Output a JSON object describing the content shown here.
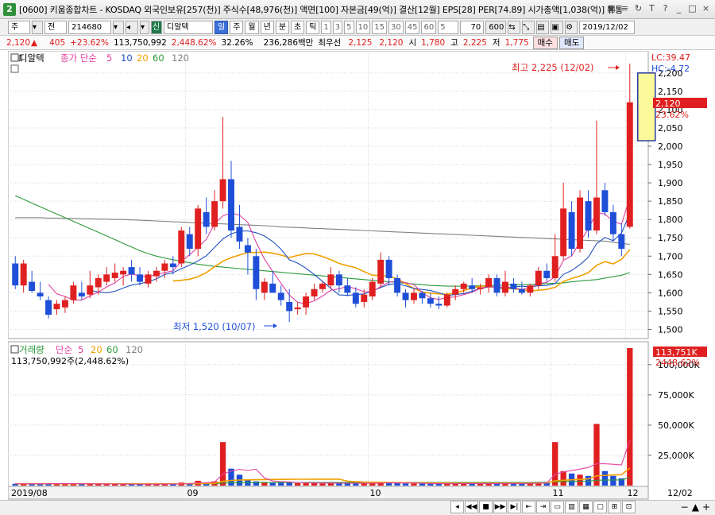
{
  "window": {
    "title": "[0600] 키움종합차트 - KOSDAQ 외국인보유[257(천)] 주식수[48,976(천)] 액면[100] 자본금[49(억)] 결산[12월] EPS[28] PER[74.89] 시가총액[1,038(억)] 유통비",
    "icon_text": "2",
    "buttons": [
      "▣",
      "≡",
      "↻",
      "T",
      "?",
      "_",
      "□",
      "×"
    ]
  },
  "toolbar": {
    "type": "주",
    "market": "전",
    "code": "214680",
    "badge": "신",
    "name": "디알텍",
    "periods": [
      "일",
      "주",
      "월",
      "년",
      "분",
      "초",
      "틱"
    ],
    "minutes": [
      "1",
      "3",
      "5",
      "10",
      "15",
      "30",
      "45",
      "60",
      "5"
    ],
    "count": "70",
    "total": "600",
    "date": "2019/12/02"
  },
  "quote": {
    "price": "2,120",
    "arrow": "▲",
    "change": "405",
    "pct": "+23.62%",
    "volume": "113,750,992",
    "vol_pct": "2,448.62%",
    "turnover": "32.26%",
    "amount": "236,286백만",
    "pref_label": "최우선",
    "ask": "2,125",
    "bid": "2,120",
    "open_label": "시",
    "open": "1,780",
    "high_label": "고",
    "high": "2,225",
    "low_label": "저",
    "low": "1,775",
    "sell": "매수",
    "buy": "매도"
  },
  "price_panel": {
    "name": "디알텍",
    "legend_prefix": "종가 단순",
    "ma": [
      "5",
      "10",
      "20",
      "60",
      "120"
    ],
    "lc": "LC:39.47",
    "hc": "HC:-4.72",
    "last_price": "2,120",
    "last_pct": "23.62%",
    "max_label": "최고 2,225 (12/02)",
    "min_label": "최저 1,520 (10/07)"
  },
  "volume_panel": {
    "legend_name": "거래량",
    "legend_prefix": "단순",
    "ma": [
      "5",
      "20",
      "60",
      "120"
    ],
    "info": "113,750,992주(2,448.62%)",
    "last_vol": "113,751K",
    "last_pct": "2448.62%"
  },
  "x_axis": [
    "2019/08",
    "09",
    "10",
    "11",
    "12",
    "12/02"
  ],
  "colors": {
    "up": "#e02020",
    "down": "#1f4fd8",
    "ma5": "#e040a0",
    "ma10": "#2050c0",
    "ma20": "#f0a000",
    "ma60": "#2a9a3a",
    "ma120": "#808080"
  },
  "chart_data": {
    "type": "candlestick",
    "y_price_ticks": [
      "2,200",
      "2,150",
      "2,100",
      "2,050",
      "2,000",
      "1,950",
      "1,900",
      "1,850",
      "1,800",
      "1,750",
      "1,700",
      "1,650",
      "1,600",
      "1,550",
      "1,500"
    ],
    "y_price_range": [
      1475,
      2230
    ],
    "y_volume_ticks": [
      "100,000K",
      "75,000K",
      "50,000K",
      "25,000K"
    ],
    "y_volume_range": [
      0,
      115000
    ],
    "candles": [
      {
        "o": 1680,
        "h": 1700,
        "l": 1610,
        "c": 1620,
        "v": 1500
      },
      {
        "o": 1620,
        "h": 1690,
        "l": 1600,
        "c": 1680,
        "v": 1500
      },
      {
        "o": 1630,
        "h": 1660,
        "l": 1600,
        "c": 1605,
        "v": 1500
      },
      {
        "o": 1600,
        "h": 1630,
        "l": 1580,
        "c": 1590,
        "v": 1500
      },
      {
        "o": 1580,
        "h": 1590,
        "l": 1530,
        "c": 1540,
        "v": 1800
      },
      {
        "o": 1555,
        "h": 1580,
        "l": 1540,
        "c": 1570,
        "v": 1500
      },
      {
        "o": 1560,
        "h": 1590,
        "l": 1545,
        "c": 1580,
        "v": 1500
      },
      {
        "o": 1580,
        "h": 1630,
        "l": 1570,
        "c": 1620,
        "v": 1500
      },
      {
        "o": 1600,
        "h": 1630,
        "l": 1580,
        "c": 1590,
        "v": 1200
      },
      {
        "o": 1595,
        "h": 1660,
        "l": 1585,
        "c": 1620,
        "v": 1200
      },
      {
        "o": 1615,
        "h": 1650,
        "l": 1595,
        "c": 1640,
        "v": 1200
      },
      {
        "o": 1630,
        "h": 1670,
        "l": 1620,
        "c": 1650,
        "v": 1200
      },
      {
        "o": 1640,
        "h": 1680,
        "l": 1630,
        "c": 1655,
        "v": 1200
      },
      {
        "o": 1650,
        "h": 1670,
        "l": 1620,
        "c": 1660,
        "v": 1200
      },
      {
        "o": 1670,
        "h": 1690,
        "l": 1630,
        "c": 1650,
        "v": 1200
      },
      {
        "o": 1650,
        "h": 1670,
        "l": 1620,
        "c": 1630,
        "v": 1200
      },
      {
        "o": 1625,
        "h": 1660,
        "l": 1615,
        "c": 1650,
        "v": 1200
      },
      {
        "o": 1645,
        "h": 1670,
        "l": 1630,
        "c": 1660,
        "v": 1200
      },
      {
        "o": 1660,
        "h": 1690,
        "l": 1640,
        "c": 1680,
        "v": 1300
      },
      {
        "o": 1680,
        "h": 1700,
        "l": 1650,
        "c": 1670,
        "v": 1300
      },
      {
        "o": 1680,
        "h": 1780,
        "l": 1670,
        "c": 1770,
        "v": 2500
      },
      {
        "o": 1760,
        "h": 1780,
        "l": 1700,
        "c": 1720,
        "v": 2000
      },
      {
        "o": 1720,
        "h": 1840,
        "l": 1700,
        "c": 1830,
        "v": 4000
      },
      {
        "o": 1820,
        "h": 1860,
        "l": 1760,
        "c": 1780,
        "v": 2500
      },
      {
        "o": 1780,
        "h": 1880,
        "l": 1770,
        "c": 1850,
        "v": 3500
      },
      {
        "o": 1850,
        "h": 2080,
        "l": 1830,
        "c": 1910,
        "v": 36000
      },
      {
        "o": 1910,
        "h": 1960,
        "l": 1750,
        "c": 1770,
        "v": 14000
      },
      {
        "o": 1780,
        "h": 1840,
        "l": 1720,
        "c": 1740,
        "v": 9000
      },
      {
        "o": 1730,
        "h": 1750,
        "l": 1650,
        "c": 1710,
        "v": 5000
      },
      {
        "o": 1700,
        "h": 1720,
        "l": 1580,
        "c": 1610,
        "v": 3500
      },
      {
        "o": 1600,
        "h": 1640,
        "l": 1580,
        "c": 1630,
        "v": 3000
      },
      {
        "o": 1625,
        "h": 1660,
        "l": 1600,
        "c": 1600,
        "v": 2500
      },
      {
        "o": 1600,
        "h": 1620,
        "l": 1565,
        "c": 1580,
        "v": 2500
      },
      {
        "o": 1575,
        "h": 1610,
        "l": 1520,
        "c": 1550,
        "v": 3000
      },
      {
        "o": 1555,
        "h": 1575,
        "l": 1540,
        "c": 1560,
        "v": 2000
      },
      {
        "o": 1560,
        "h": 1600,
        "l": 1540,
        "c": 1590,
        "v": 2000
      },
      {
        "o": 1590,
        "h": 1625,
        "l": 1580,
        "c": 1610,
        "v": 2000
      },
      {
        "o": 1610,
        "h": 1630,
        "l": 1600,
        "c": 1625,
        "v": 1800
      },
      {
        "o": 1620,
        "h": 1670,
        "l": 1610,
        "c": 1650,
        "v": 2000
      },
      {
        "o": 1650,
        "h": 1660,
        "l": 1600,
        "c": 1620,
        "v": 2000
      },
      {
        "o": 1620,
        "h": 1640,
        "l": 1590,
        "c": 1600,
        "v": 2000
      },
      {
        "o": 1600,
        "h": 1615,
        "l": 1560,
        "c": 1570,
        "v": 1800
      },
      {
        "o": 1575,
        "h": 1610,
        "l": 1560,
        "c": 1595,
        "v": 1800
      },
      {
        "o": 1590,
        "h": 1640,
        "l": 1580,
        "c": 1630,
        "v": 2000
      },
      {
        "o": 1625,
        "h": 1710,
        "l": 1615,
        "c": 1690,
        "v": 3000
      },
      {
        "o": 1690,
        "h": 1700,
        "l": 1620,
        "c": 1640,
        "v": 2500
      },
      {
        "o": 1640,
        "h": 1650,
        "l": 1590,
        "c": 1600,
        "v": 2000
      },
      {
        "o": 1600,
        "h": 1610,
        "l": 1560,
        "c": 1580,
        "v": 1800
      },
      {
        "o": 1580,
        "h": 1610,
        "l": 1570,
        "c": 1600,
        "v": 1800
      },
      {
        "o": 1600,
        "h": 1605,
        "l": 1570,
        "c": 1585,
        "v": 1600
      },
      {
        "o": 1585,
        "h": 1600,
        "l": 1560,
        "c": 1570,
        "v": 1600
      },
      {
        "o": 1570,
        "h": 1590,
        "l": 1555,
        "c": 1565,
        "v": 1600
      },
      {
        "o": 1565,
        "h": 1600,
        "l": 1560,
        "c": 1595,
        "v": 1600
      },
      {
        "o": 1595,
        "h": 1620,
        "l": 1580,
        "c": 1610,
        "v": 1800
      },
      {
        "o": 1610,
        "h": 1630,
        "l": 1600,
        "c": 1625,
        "v": 1800
      },
      {
        "o": 1620,
        "h": 1640,
        "l": 1600,
        "c": 1610,
        "v": 1600
      },
      {
        "o": 1610,
        "h": 1625,
        "l": 1595,
        "c": 1615,
        "v": 1600
      },
      {
        "o": 1615,
        "h": 1650,
        "l": 1600,
        "c": 1640,
        "v": 1800
      },
      {
        "o": 1640,
        "h": 1650,
        "l": 1590,
        "c": 1600,
        "v": 1800
      },
      {
        "o": 1600,
        "h": 1660,
        "l": 1590,
        "c": 1630,
        "v": 2000
      },
      {
        "o": 1625,
        "h": 1640,
        "l": 1600,
        "c": 1610,
        "v": 1800
      },
      {
        "o": 1610,
        "h": 1630,
        "l": 1595,
        "c": 1600,
        "v": 1600
      },
      {
        "o": 1600,
        "h": 1625,
        "l": 1590,
        "c": 1620,
        "v": 1800
      },
      {
        "o": 1620,
        "h": 1670,
        "l": 1610,
        "c": 1660,
        "v": 3000
      },
      {
        "o": 1660,
        "h": 1680,
        "l": 1630,
        "c": 1640,
        "v": 3000
      },
      {
        "o": 1640,
        "h": 1760,
        "l": 1630,
        "c": 1700,
        "v": 36000
      },
      {
        "o": 1700,
        "h": 1900,
        "l": 1690,
        "c": 1830,
        "v": 12000
      },
      {
        "o": 1820,
        "h": 1850,
        "l": 1700,
        "c": 1720,
        "v": 10000
      },
      {
        "o": 1720,
        "h": 1880,
        "l": 1710,
        "c": 1860,
        "v": 9000
      },
      {
        "o": 1850,
        "h": 1880,
        "l": 1750,
        "c": 1770,
        "v": 8000
      },
      {
        "o": 1770,
        "h": 2070,
        "l": 1760,
        "c": 1860,
        "v": 51000
      },
      {
        "o": 1880,
        "h": 1900,
        "l": 1810,
        "c": 1820,
        "v": 12000
      },
      {
        "o": 1820,
        "h": 1840,
        "l": 1740,
        "c": 1760,
        "v": 8000
      },
      {
        "o": 1760,
        "h": 1790,
        "l": 1700,
        "c": 1720,
        "v": 6000
      },
      {
        "o": 1780,
        "h": 2225,
        "l": 1775,
        "c": 2120,
        "v": 113751
      }
    ],
    "ma5": [
      null,
      null,
      null,
      null,
      1623,
      1597,
      1590,
      1580,
      1580,
      1592,
      1602,
      1616,
      1627,
      1645,
      1651,
      1647,
      1643,
      1650,
      1655,
      1660,
      1686,
      1704,
      1724,
      1746,
      1788,
      1810,
      1818,
      1812,
      1792,
      1738,
      1692,
      1658,
      1626,
      1594,
      1574,
      1570,
      1578,
      1591,
      1607,
      1611,
      1617,
      1611,
      1603,
      1603,
      1617,
      1629,
      1631,
      1628,
      1622,
      1601,
      1586,
      1582,
      1587,
      1589,
      1595,
      1601,
      1612,
      1618,
      1614,
      1617,
      1613,
      1609,
      1614,
      1626,
      1628,
      1644,
      1688,
      1701,
      1739,
      1774,
      1819,
      1815,
      1795,
      1787,
      1860
    ],
    "ma10": [
      null,
      null,
      null,
      null,
      null,
      null,
      null,
      null,
      null,
      1607,
      1602,
      1600,
      1604,
      1613,
      1621,
      1625,
      1630,
      1638,
      1650,
      1655,
      1666,
      1675,
      1687,
      1701,
      1724,
      1747,
      1761,
      1768,
      1769,
      1764,
      1755,
      1740,
      1719,
      1690,
      1681,
      1667,
      1650,
      1631,
      1612,
      1594,
      1593,
      1595,
      1597,
      1605,
      1614,
      1623,
      1625,
      1619,
      1612,
      1609,
      1606,
      1600,
      1593,
      1595,
      1598,
      1604,
      1612,
      1616,
      1615,
      1612,
      1616,
      1618,
      1616,
      1619,
      1620,
      1625,
      1650,
      1661,
      1677,
      1697,
      1734,
      1751,
      1742,
      1763,
      1817
    ],
    "ma20": [
      null,
      null,
      null,
      null,
      null,
      null,
      null,
      null,
      null,
      null,
      null,
      null,
      null,
      null,
      null,
      null,
      null,
      null,
      null,
      1632,
      1634,
      1637,
      1644,
      1655,
      1671,
      1686,
      1696,
      1703,
      1710,
      1710,
      1711,
      1708,
      1703,
      1696,
      1702,
      1707,
      1706,
      1699,
      1690,
      1680,
      1674,
      1668,
      1658,
      1648,
      1647,
      1645,
      1638,
      1625,
      1612,
      1602,
      1599,
      1597,
      1596,
      1600,
      1606,
      1613,
      1618,
      1618,
      1614,
      1611,
      1611,
      1609,
      1605,
      1607,
      1609,
      1615,
      1631,
      1639,
      1646,
      1655,
      1675,
      1685,
      1679,
      1691,
      1718
    ],
    "ma60": [
      1865,
      1855,
      1845,
      1835,
      1825,
      1815,
      1805,
      1795,
      1785,
      1775,
      1765,
      1755,
      1745,
      1735,
      1725,
      1715,
      1707,
      1700,
      1695,
      1690,
      1686,
      1682,
      1678,
      1675,
      1672,
      1670,
      1668,
      1666,
      1664,
      1662,
      1660,
      1658,
      1656,
      1654,
      1652,
      1650,
      1648,
      1646,
      1644,
      1642,
      1640,
      1638,
      1636,
      1634,
      1632,
      1630,
      1628,
      1626,
      1624,
      1622,
      1620,
      1619,
      1618,
      1618,
      1618,
      1618,
      1619,
      1620,
      1620,
      1621,
      1622,
      1622,
      1623,
      1624,
      1625,
      1626,
      1627,
      1630,
      1632,
      1634,
      1636,
      1640,
      1644,
      1648,
      1655
    ],
    "ma120": [
      1805,
      1805,
      1805,
      1805,
      1804,
      1804,
      1803,
      1803,
      1802,
      1802,
      1801,
      1801,
      1800,
      1800,
      1799,
      1798,
      1797,
      1796,
      1795,
      1794,
      1793,
      1792,
      1791,
      1790,
      1789,
      1788,
      1787,
      1786,
      1785,
      1784,
      1783,
      1782,
      1780,
      1779,
      1778,
      1777,
      1776,
      1775,
      1774,
      1773,
      1772,
      1771,
      1770,
      1769,
      1768,
      1767,
      1766,
      1765,
      1764,
      1763,
      1762,
      1761,
      1760,
      1759,
      1758,
      1757,
      1756,
      1755,
      1754,
      1753,
      1752,
      1751,
      1750,
      1749,
      1748,
      1747,
      1746,
      1745,
      1744,
      1743,
      1742,
      1741,
      1738,
      1735,
      1732
    ],
    "vma5": [
      1500,
      1500,
      1500,
      1500,
      1560,
      1560,
      1560,
      1560,
      1560,
      1500,
      1440,
      1380,
      1320,
      1260,
      1200,
      1200,
      1200,
      1200,
      1220,
      1240,
      1460,
      1620,
      2140,
      2460,
      2900,
      9700,
      12000,
      13500,
      12500,
      13600,
      6300,
      3800,
      3300,
      3000,
      2600,
      2300,
      2200,
      2100,
      2100,
      2000,
      2000,
      1900,
      1900,
      1900,
      2100,
      2300,
      2200,
      2200,
      2200,
      2000,
      1800,
      1700,
      1600,
      1600,
      1700,
      1700,
      1700,
      1700,
      1700,
      1800,
      1800,
      1800,
      1800,
      2000,
      2200,
      9300,
      11300,
      12400,
      13700,
      15000,
      18000,
      18000,
      17600,
      17000,
      37500
    ],
    "vma20": [
      1500,
      1500,
      1500,
      1500,
      1500,
      1500,
      1500,
      1500,
      1500,
      1500,
      1500,
      1500,
      1500,
      1500,
      1500,
      1500,
      1500,
      1500,
      1500,
      1500,
      1530,
      1560,
      1690,
      1760,
      1850,
      3550,
      4190,
      4580,
      4760,
      4880,
      4980,
      5050,
      5120,
      5200,
      5240,
      5260,
      5300,
      5320,
      5340,
      5350,
      3700,
      3200,
      2900,
      2800,
      2700,
      2600,
      2500,
      2400,
      2300,
      2200,
      2100,
      2100,
      2100,
      2000,
      2000,
      2000,
      2000,
      2000,
      2000,
      2000,
      2000,
      2000,
      2000,
      2100,
      2200,
      3900,
      4400,
      4800,
      5200,
      5500,
      8000,
      8500,
      8800,
      9000,
      14500
    ],
    "vma60": [
      1400,
      1400,
      1400,
      1400,
      1400,
      1400,
      1400,
      1400,
      1400,
      1400,
      1400,
      1400,
      1400,
      1400,
      1400,
      1400,
      1400,
      1400,
      1400,
      1400,
      1420,
      1440,
      1480,
      1500,
      1530,
      2100,
      2300,
      2400,
      2450,
      2480,
      2500,
      2520,
      2540,
      2560,
      2570,
      2580,
      2590,
      2600,
      2610,
      2620,
      2620,
      2620,
      2620,
      2630,
      2640,
      2650,
      2650,
      2650,
      2650,
      2650,
      2650,
      2650,
      2650,
      2650,
      2650,
      2650,
      2650,
      2650,
      2650,
      2660,
      2660,
      2660,
      2660,
      2680,
      2700,
      3200,
      3300,
      3400,
      3500,
      3600,
      4400,
      4550,
      4650,
      4750,
      6500
    ]
  }
}
